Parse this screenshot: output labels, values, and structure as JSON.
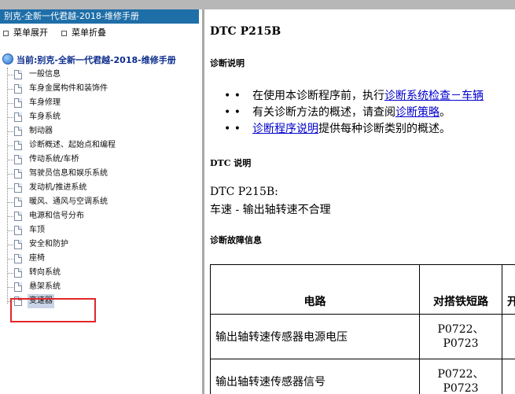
{
  "window": {
    "left_title": "别克-全新一代君越-2018-维修手册"
  },
  "menu": {
    "expand_label": "菜单展开",
    "collapse_label": "菜单折叠"
  },
  "tree": {
    "root_label": "当前:别克-全新一代君越-2018-维修手册",
    "items": [
      "一般信息",
      "车身金属构件和装饰件",
      "车身修理",
      "车身系统",
      "制动器",
      "诊断概述、起始点和编程",
      "传动系统/车桥",
      "驾驶员信息和娱乐系统",
      "发动机/推进系统",
      "暖风、通风与空调系统",
      "电源和信号分布",
      "车顶",
      "安全和防护",
      "座椅",
      "转向系统",
      "悬架系统",
      "变速器"
    ],
    "selected_index": 16
  },
  "colors": {
    "title_bar": "#1e6ea8",
    "link": "#0000cc",
    "highlight_box": "#e0262a",
    "divider": "#a8a8a8"
  },
  "doc": {
    "dtc_heading": "DTC P215B",
    "diag_instructions_heading": "诊断说明",
    "bullet_marker": "• •",
    "bullets": [
      {
        "pre": "在使用本诊断程序前，执行",
        "link": "诊断系统检查－车辆",
        "post": ""
      },
      {
        "pre": "有关诊断方法的概述，请查阅",
        "link": "诊断策略",
        "post": "。"
      },
      {
        "pre": "",
        "link": "诊断程序说明",
        "post": "提供每种诊断类别的概述。"
      }
    ],
    "dtc_desc_heading": "DTC 说明",
    "dtc_code_line": "DTC P215B:",
    "dtc_desc_line": "车速 - 输出轴转速不合理",
    "fault_info_heading": "诊断故障信息",
    "table": {
      "headers": [
        "电路",
        "对搭铁短路",
        "开"
      ],
      "rows": [
        {
          "circuit": "输出轴转速传感器电源电压",
          "codes": [
            "P0722、",
            "P0723"
          ]
        },
        {
          "circuit": "输出轴转速传感器信号",
          "codes": [
            "P0722、",
            "P0723"
          ]
        }
      ]
    }
  }
}
